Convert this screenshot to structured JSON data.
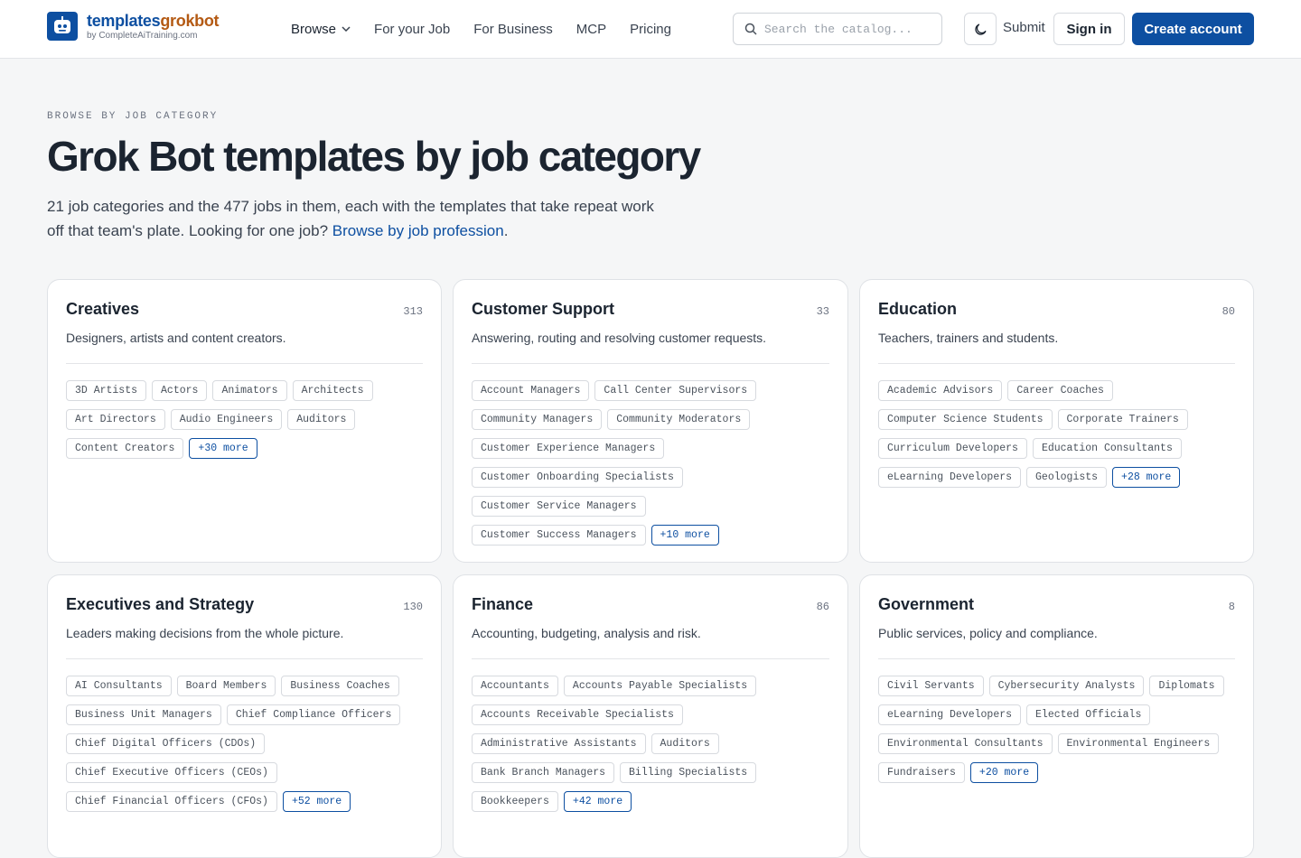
{
  "brand": {
    "name_a": "templates",
    "name_b": "grokbot",
    "sub": "by CompleteAiTraining.com"
  },
  "nav": [
    "Browse",
    "For your Job",
    "For Business",
    "MCP",
    "Pricing"
  ],
  "search": {
    "placeholder": "Search the catalog..."
  },
  "header_actions": {
    "submit": "Submit",
    "signin": "Sign in",
    "create": "Create account"
  },
  "hero": {
    "eyebrow": "BROWSE BY JOB CATEGORY",
    "title": "Grok Bot templates by job category",
    "intro": "21 job categories and the 477 jobs in them, each with the templates that take repeat work off that team's plate. Looking for one job? ",
    "intro_link": "Browse by job profession",
    "intro_end": "."
  },
  "categories": [
    {
      "title": "Creatives",
      "count": "313",
      "desc": "Designers, artists and content creators.",
      "jobs": [
        "3D Artists",
        "Actors",
        "Animators",
        "Architects",
        "Art Directors",
        "Audio Engineers",
        "Auditors",
        "Content Creators"
      ],
      "more": "+30 more"
    },
    {
      "title": "Customer Support",
      "count": "33",
      "desc": "Answering, routing and resolving customer requests.",
      "jobs": [
        "Account Managers",
        "Call Center Supervisors",
        "Community Managers",
        "Community Moderators",
        "Customer Experience Managers",
        "Customer Onboarding Specialists",
        "Customer Service Managers",
        "Customer Success Managers"
      ],
      "more": "+10 more"
    },
    {
      "title": "Education",
      "count": "80",
      "desc": "Teachers, trainers and students.",
      "jobs": [
        "Academic Advisors",
        "Career Coaches",
        "Computer Science Students",
        "Corporate Trainers",
        "Curriculum Developers",
        "Education Consultants",
        "eLearning Developers",
        "Geologists"
      ],
      "more": "+28 more"
    },
    {
      "title": "Executives and Strategy",
      "count": "130",
      "desc": "Leaders making decisions from the whole picture.",
      "jobs": [
        "AI Consultants",
        "Board Members",
        "Business Coaches",
        "Business Unit Managers",
        "Chief Compliance Officers",
        "Chief Digital Officers (CDOs)",
        "Chief Executive Officers (CEOs)",
        "Chief Financial Officers (CFOs)"
      ],
      "more": "+52 more"
    },
    {
      "title": "Finance",
      "count": "86",
      "desc": "Accounting, budgeting, analysis and risk.",
      "jobs": [
        "Accountants",
        "Accounts Payable Specialists",
        "Accounts Receivable Specialists",
        "Administrative Assistants",
        "Auditors",
        "Bank Branch Managers",
        "Billing Specialists",
        "Bookkeepers"
      ],
      "more": "+42 more"
    },
    {
      "title": "Government",
      "count": "8",
      "desc": "Public services, policy and compliance.",
      "jobs": [
        "Civil Servants",
        "Cybersecurity Analysts",
        "Diplomats",
        "eLearning Developers",
        "Elected Officials",
        "Environmental Consultants",
        "Environmental Engineers",
        "Fundraisers"
      ],
      "more": "+20 more"
    }
  ]
}
